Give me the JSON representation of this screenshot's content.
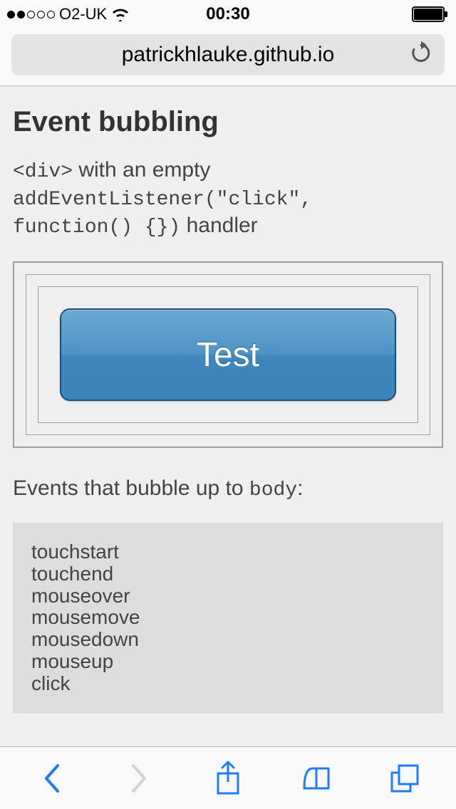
{
  "statusbar": {
    "carrier": "O2-UK",
    "time": "00:30"
  },
  "browser": {
    "url": "patrickhlauke.github.io"
  },
  "page": {
    "heading": "Event bubbling",
    "desc_code1": "<div>",
    "desc_text1": " with an empty ",
    "desc_code2": "addEventListener(\"click\", function() {})",
    "desc_text2": " handler",
    "button_label": "Test",
    "events_label_pre": "Events that bubble up to ",
    "events_label_code": "body",
    "events_label_post": ":",
    "events": [
      "touchstart",
      "touchend",
      "mouseover",
      "mousemove",
      "mousedown",
      "mouseup",
      "click"
    ]
  }
}
